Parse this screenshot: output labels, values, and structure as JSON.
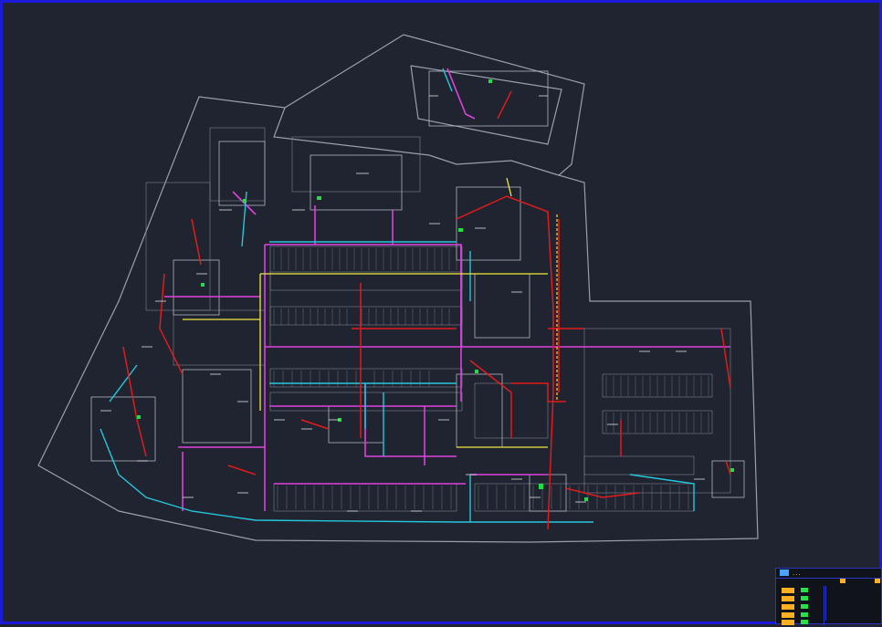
{
  "drawing": {
    "title_block": {
      "title": "...",
      "legend_rows": 5
    },
    "colors": {
      "background": "#1f2430",
      "frame": "#1a1ad8",
      "outline": "#9aa0aa",
      "red": "#e21b1b",
      "magenta": "#e040e0",
      "cyan": "#26c6da",
      "yellow": "#f2e640",
      "green": "#22dd44",
      "orange": "#ffb020"
    }
  }
}
